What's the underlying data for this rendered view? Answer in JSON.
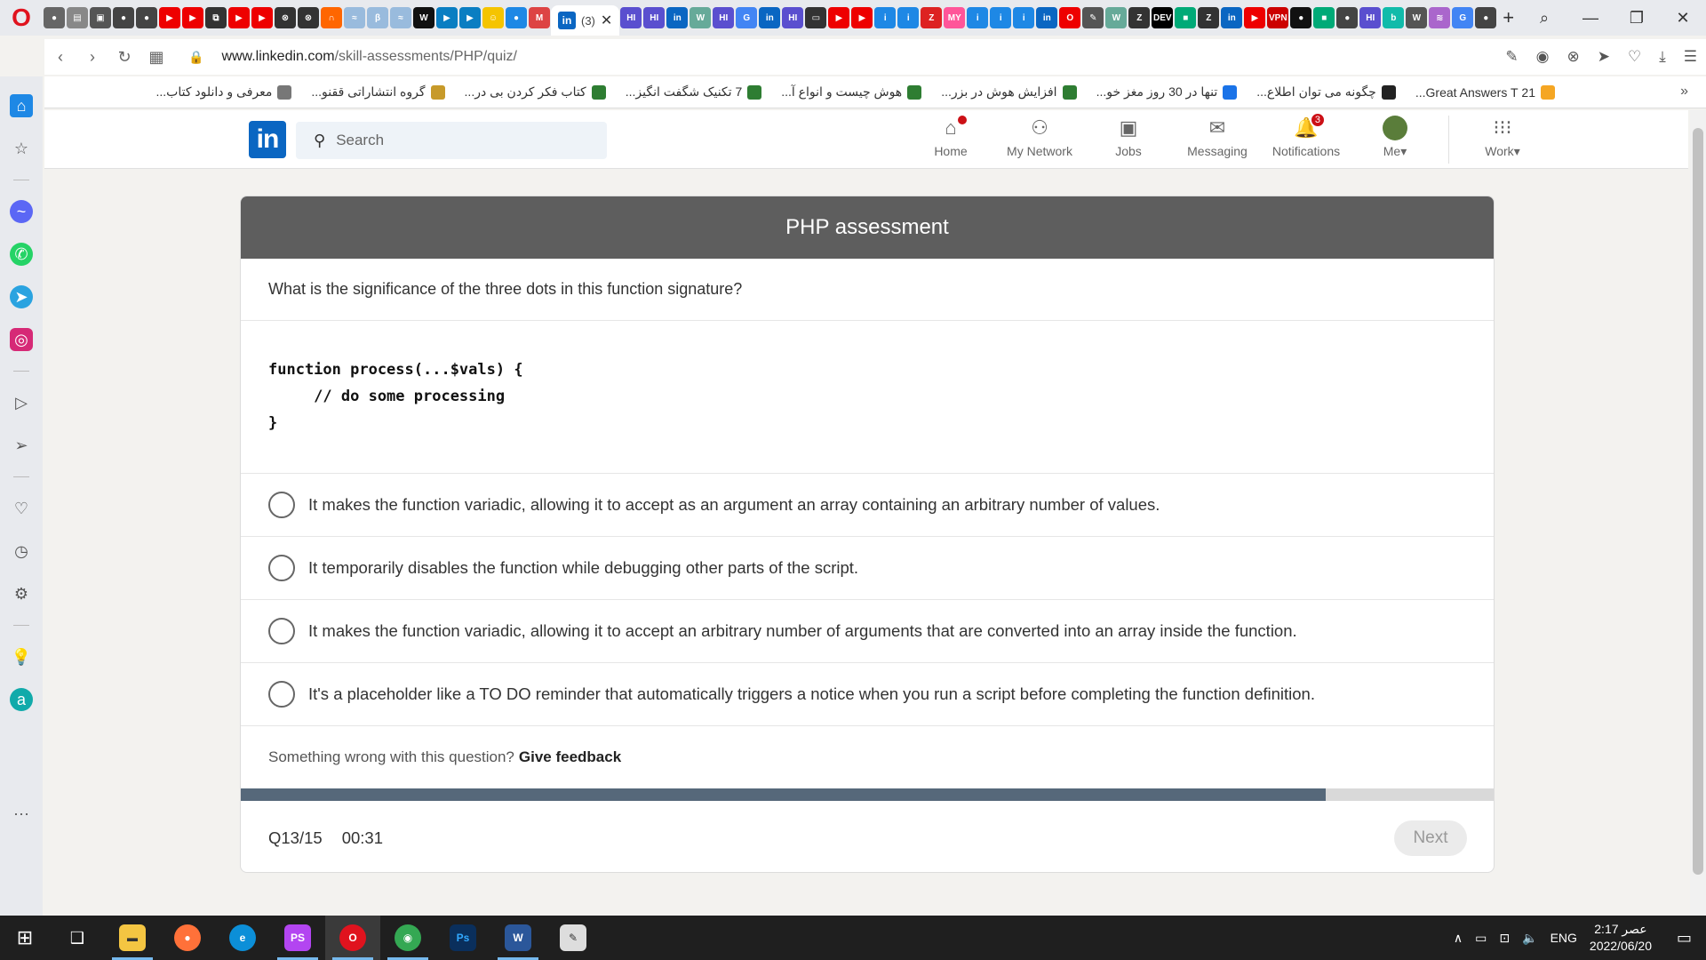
{
  "browser": {
    "active_tab_count": "(3)",
    "url_host": "www.linkedin.com",
    "url_path": "/skill-assessments/PHP/quiz/"
  },
  "bookmarks": [
    {
      "label": "21 Great Answers T...",
      "color": "#f5a623"
    },
    {
      "label": "چگونه می توان اطلاع...",
      "color": "#222222"
    },
    {
      "label": "تنها در 30 روز مغز خو...",
      "color": "#1a73e8"
    },
    {
      "label": "افزایش هوش در بزر...",
      "color": "#2e7d32"
    },
    {
      "label": "هوش چیست و انواع آ...",
      "color": "#2e7d32"
    },
    {
      "label": "7 تکنیک شگفت انگیز...",
      "color": "#2e7d32"
    },
    {
      "label": "کتاب فکر کردن بی در...",
      "color": "#2e7d32"
    },
    {
      "label": "گروه انتشاراتی ققنو...",
      "color": "#c79a2a"
    },
    {
      "label": "معرفی و دانلود کتاب...",
      "color": "#777777"
    }
  ],
  "linkedin": {
    "logo": "in",
    "search_placeholder": "Search",
    "nav": [
      {
        "label": "Home",
        "icon": "home-icon",
        "badge": ""
      },
      {
        "label": "My Network",
        "icon": "network-icon",
        "badge": ""
      },
      {
        "label": "Jobs",
        "icon": "briefcase-icon",
        "badge": ""
      },
      {
        "label": "Messaging",
        "icon": "message-icon",
        "badge": ""
      },
      {
        "label": "Notifications",
        "icon": "bell-icon",
        "badge": "3"
      }
    ],
    "me_label": "Me",
    "work_label": "Work"
  },
  "assessment": {
    "title": "PHP assessment",
    "question": "What is the significance of the three dots in this function signature?",
    "code": "function process(...$vals) {\n     // do some processing\n}",
    "options": [
      "It makes the function variadic, allowing it to accept as an argument an array containing an arbitrary number of values.",
      "It temporarily disables the function while debugging other parts of the script.",
      "It makes the function variadic, allowing it to accept an arbitrary number of arguments that are converted into an array inside the function.",
      "It's a placeholder like a TO DO reminder that automatically triggers a notice when you run a script before completing the function definition."
    ],
    "feedback_text": "Something wrong with this question?",
    "feedback_link": "Give feedback",
    "progress_fraction": 0.866,
    "question_counter": "Q13/15",
    "timer": "00:31",
    "next_label": "Next"
  },
  "taskbar": {
    "language": "ENG",
    "time": "2:17 عصر",
    "date": "2022/06/20"
  }
}
